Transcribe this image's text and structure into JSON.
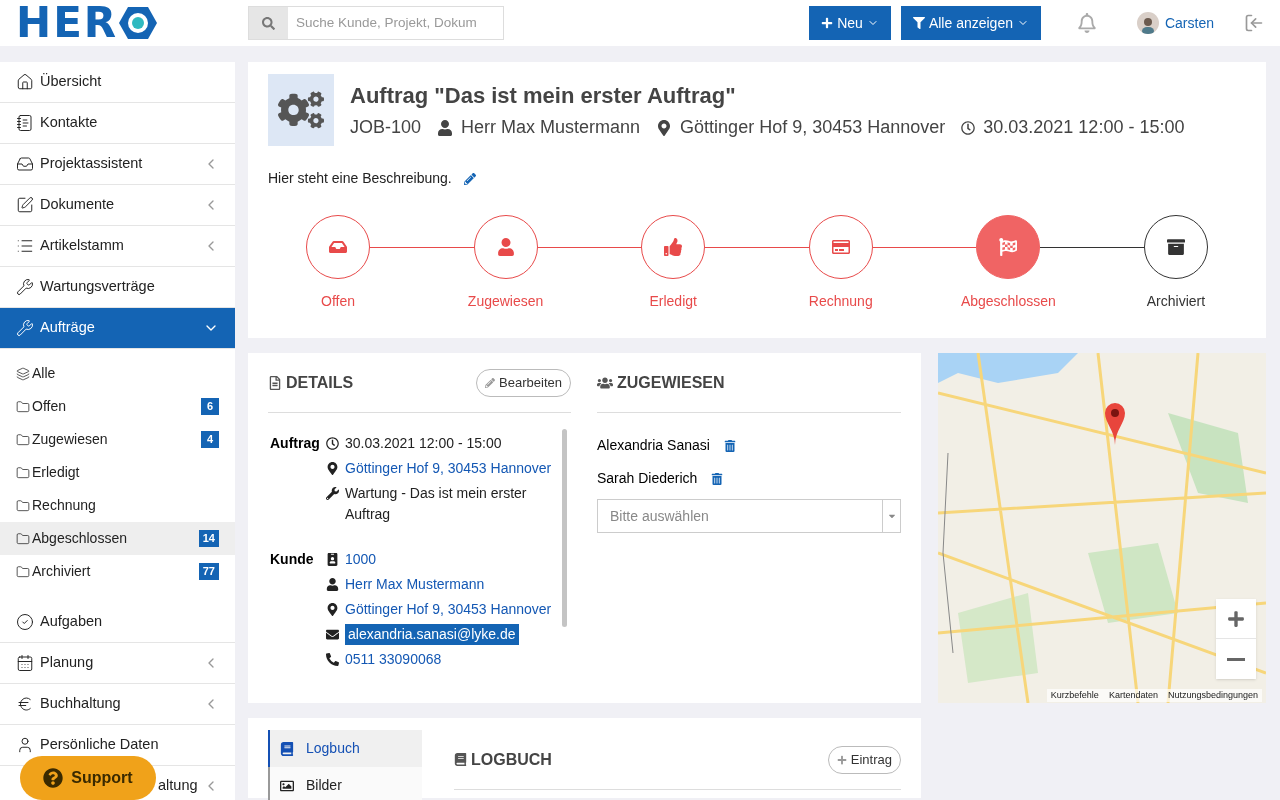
{
  "logo": {
    "text": "HER"
  },
  "search": {
    "placeholder": "Suche Kunde, Projekt, Dokum"
  },
  "header_buttons": [
    {
      "kind": "new",
      "label": "Neu"
    },
    {
      "kind": "filter",
      "label": "Alle anzeigen"
    }
  ],
  "user": {
    "name": "Carsten"
  },
  "sidebar": {
    "items": [
      {
        "label": "Übersicht",
        "submenu": false,
        "selected": false
      },
      {
        "label": "Kontakte",
        "submenu": false,
        "selected": false
      },
      {
        "label": "Projektassistent",
        "submenu": true,
        "selected": false
      },
      {
        "label": "Dokumente",
        "submenu": true,
        "selected": false
      },
      {
        "label": "Artikelstamm",
        "submenu": true,
        "selected": false
      },
      {
        "label": "Wartungsverträge",
        "submenu": false,
        "selected": false
      },
      {
        "label": "Aufträge",
        "submenu": true,
        "selected": true,
        "expanded": true,
        "children": [
          {
            "label": "Alle",
            "selected": false
          },
          {
            "label": "Offen",
            "count": "6",
            "selected": false
          },
          {
            "label": "Zugewiesen",
            "count": "4",
            "selected": false
          },
          {
            "label": "Erledigt",
            "selected": false
          },
          {
            "label": "Rechnung",
            "selected": false
          },
          {
            "label": "Abgeschlossen",
            "count": "14",
            "selected": true
          },
          {
            "label": "Archiviert",
            "count": "77",
            "selected": false
          }
        ]
      },
      {
        "label": "Aufgaben",
        "submenu": false,
        "selected": false
      },
      {
        "label": "Planung",
        "submenu": true,
        "selected": false
      },
      {
        "label": "Buchhaltung",
        "submenu": true,
        "selected": false
      },
      {
        "label": "Persönliche Daten",
        "submenu": false,
        "selected": false
      },
      {
        "label": "altung",
        "submenu": true,
        "selected": false
      }
    ]
  },
  "support_button": {
    "label": "Support"
  },
  "job": {
    "title": "Auftrag \"Das ist mein erster Auftrag\"",
    "number": "JOB-100",
    "customer": "Herr Max Mustermann",
    "address": "Göttinger Hof 9, 30453 Hannover",
    "date": "30.03.2021 12:00 - 15:00",
    "description": "Hier steht eine Beschreibung.",
    "steps": [
      {
        "label": "Offen",
        "completed": true,
        "selected": false
      },
      {
        "label": "Zugewiesen",
        "completed": true,
        "selected": false
      },
      {
        "label": "Erledigt",
        "completed": true,
        "selected": false
      },
      {
        "label": "Rechnung",
        "completed": true,
        "selected": false
      },
      {
        "label": "Abgeschlossen",
        "completed": true,
        "selected": true
      },
      {
        "label": "Archiviert",
        "completed": false,
        "selected": false
      }
    ]
  },
  "details": {
    "title": "DETAILS",
    "edit_button": "Bearbeiten",
    "groups": [
      {
        "label": "Auftrag",
        "rows": [
          {
            "text": "30.03.2021 12:00 - 15:00",
            "link": false,
            "highlighted": false
          },
          {
            "text": "Göttinger Hof 9, 30453 Hannover",
            "link": true,
            "highlighted": false
          },
          {
            "text": "Wartung - Das ist mein erster Auftrag",
            "link": false,
            "highlighted": false
          }
        ]
      },
      {
        "label": "Kunde",
        "rows": [
          {
            "text": "1000",
            "link": true,
            "highlighted": false
          },
          {
            "text": "Herr Max Mustermann",
            "link": true,
            "highlighted": false
          },
          {
            "text": "Göttinger Hof 9, 30453 Hannover",
            "link": true,
            "highlighted": false
          },
          {
            "text": "alexandria.sanasi@lyke.de",
            "link": true,
            "highlighted": true
          },
          {
            "text": "0511 33090068",
            "link": true,
            "highlighted": false
          }
        ]
      }
    ]
  },
  "assigned": {
    "title": "ZUGEWIESEN",
    "people": [
      "Alexandria Sanasi",
      "Sarah Diederich"
    ],
    "select_placeholder": "Bitte auswählen"
  },
  "map": {
    "kind": "picture",
    "attribution": [
      "Kurzbefehle",
      "Kartendaten",
      "Nutzungsbedingungen"
    ]
  },
  "log": {
    "tabs": [
      {
        "label": "Logbuch",
        "selected": true
      },
      {
        "label": "Bilder",
        "selected": false
      }
    ],
    "title": "LOGBUCH",
    "add_button": "Eintrag"
  }
}
